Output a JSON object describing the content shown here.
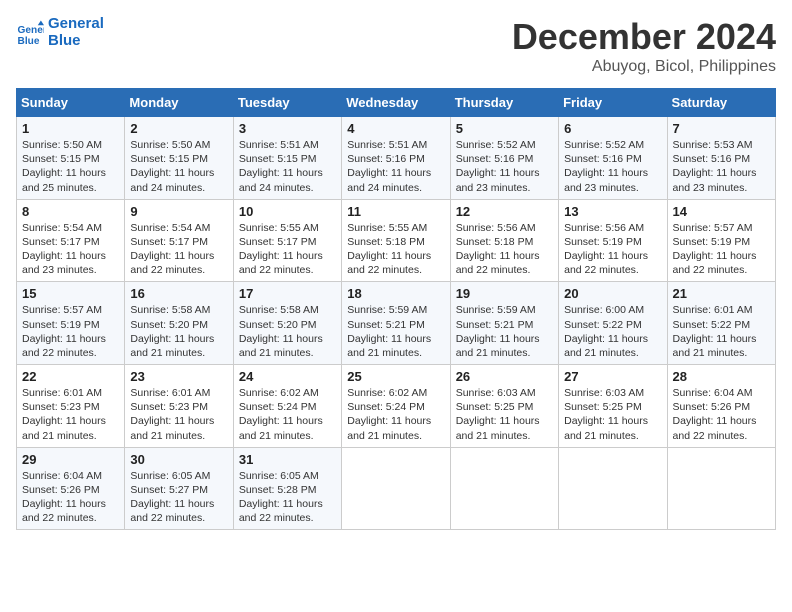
{
  "logo": {
    "line1": "General",
    "line2": "Blue"
  },
  "title": "December 2024",
  "location": "Abuyog, Bicol, Philippines",
  "days_of_week": [
    "Sunday",
    "Monday",
    "Tuesday",
    "Wednesday",
    "Thursday",
    "Friday",
    "Saturday"
  ],
  "weeks": [
    [
      {
        "day": "1",
        "info": "Sunrise: 5:50 AM\nSunset: 5:15 PM\nDaylight: 11 hours\nand 25 minutes."
      },
      {
        "day": "2",
        "info": "Sunrise: 5:50 AM\nSunset: 5:15 PM\nDaylight: 11 hours\nand 24 minutes."
      },
      {
        "day": "3",
        "info": "Sunrise: 5:51 AM\nSunset: 5:15 PM\nDaylight: 11 hours\nand 24 minutes."
      },
      {
        "day": "4",
        "info": "Sunrise: 5:51 AM\nSunset: 5:16 PM\nDaylight: 11 hours\nand 24 minutes."
      },
      {
        "day": "5",
        "info": "Sunrise: 5:52 AM\nSunset: 5:16 PM\nDaylight: 11 hours\nand 23 minutes."
      },
      {
        "day": "6",
        "info": "Sunrise: 5:52 AM\nSunset: 5:16 PM\nDaylight: 11 hours\nand 23 minutes."
      },
      {
        "day": "7",
        "info": "Sunrise: 5:53 AM\nSunset: 5:16 PM\nDaylight: 11 hours\nand 23 minutes."
      }
    ],
    [
      {
        "day": "8",
        "info": "Sunrise: 5:54 AM\nSunset: 5:17 PM\nDaylight: 11 hours\nand 23 minutes."
      },
      {
        "day": "9",
        "info": "Sunrise: 5:54 AM\nSunset: 5:17 PM\nDaylight: 11 hours\nand 22 minutes."
      },
      {
        "day": "10",
        "info": "Sunrise: 5:55 AM\nSunset: 5:17 PM\nDaylight: 11 hours\nand 22 minutes."
      },
      {
        "day": "11",
        "info": "Sunrise: 5:55 AM\nSunset: 5:18 PM\nDaylight: 11 hours\nand 22 minutes."
      },
      {
        "day": "12",
        "info": "Sunrise: 5:56 AM\nSunset: 5:18 PM\nDaylight: 11 hours\nand 22 minutes."
      },
      {
        "day": "13",
        "info": "Sunrise: 5:56 AM\nSunset: 5:19 PM\nDaylight: 11 hours\nand 22 minutes."
      },
      {
        "day": "14",
        "info": "Sunrise: 5:57 AM\nSunset: 5:19 PM\nDaylight: 11 hours\nand 22 minutes."
      }
    ],
    [
      {
        "day": "15",
        "info": "Sunrise: 5:57 AM\nSunset: 5:19 PM\nDaylight: 11 hours\nand 22 minutes."
      },
      {
        "day": "16",
        "info": "Sunrise: 5:58 AM\nSunset: 5:20 PM\nDaylight: 11 hours\nand 21 minutes."
      },
      {
        "day": "17",
        "info": "Sunrise: 5:58 AM\nSunset: 5:20 PM\nDaylight: 11 hours\nand 21 minutes."
      },
      {
        "day": "18",
        "info": "Sunrise: 5:59 AM\nSunset: 5:21 PM\nDaylight: 11 hours\nand 21 minutes."
      },
      {
        "day": "19",
        "info": "Sunrise: 5:59 AM\nSunset: 5:21 PM\nDaylight: 11 hours\nand 21 minutes."
      },
      {
        "day": "20",
        "info": "Sunrise: 6:00 AM\nSunset: 5:22 PM\nDaylight: 11 hours\nand 21 minutes."
      },
      {
        "day": "21",
        "info": "Sunrise: 6:01 AM\nSunset: 5:22 PM\nDaylight: 11 hours\nand 21 minutes."
      }
    ],
    [
      {
        "day": "22",
        "info": "Sunrise: 6:01 AM\nSunset: 5:23 PM\nDaylight: 11 hours\nand 21 minutes."
      },
      {
        "day": "23",
        "info": "Sunrise: 6:01 AM\nSunset: 5:23 PM\nDaylight: 11 hours\nand 21 minutes."
      },
      {
        "day": "24",
        "info": "Sunrise: 6:02 AM\nSunset: 5:24 PM\nDaylight: 11 hours\nand 21 minutes."
      },
      {
        "day": "25",
        "info": "Sunrise: 6:02 AM\nSunset: 5:24 PM\nDaylight: 11 hours\nand 21 minutes."
      },
      {
        "day": "26",
        "info": "Sunrise: 6:03 AM\nSunset: 5:25 PM\nDaylight: 11 hours\nand 21 minutes."
      },
      {
        "day": "27",
        "info": "Sunrise: 6:03 AM\nSunset: 5:25 PM\nDaylight: 11 hours\nand 21 minutes."
      },
      {
        "day": "28",
        "info": "Sunrise: 6:04 AM\nSunset: 5:26 PM\nDaylight: 11 hours\nand 22 minutes."
      }
    ],
    [
      {
        "day": "29",
        "info": "Sunrise: 6:04 AM\nSunset: 5:26 PM\nDaylight: 11 hours\nand 22 minutes."
      },
      {
        "day": "30",
        "info": "Sunrise: 6:05 AM\nSunset: 5:27 PM\nDaylight: 11 hours\nand 22 minutes."
      },
      {
        "day": "31",
        "info": "Sunrise: 6:05 AM\nSunset: 5:28 PM\nDaylight: 11 hours\nand 22 minutes."
      },
      {
        "day": "",
        "info": ""
      },
      {
        "day": "",
        "info": ""
      },
      {
        "day": "",
        "info": ""
      },
      {
        "day": "",
        "info": ""
      }
    ]
  ]
}
